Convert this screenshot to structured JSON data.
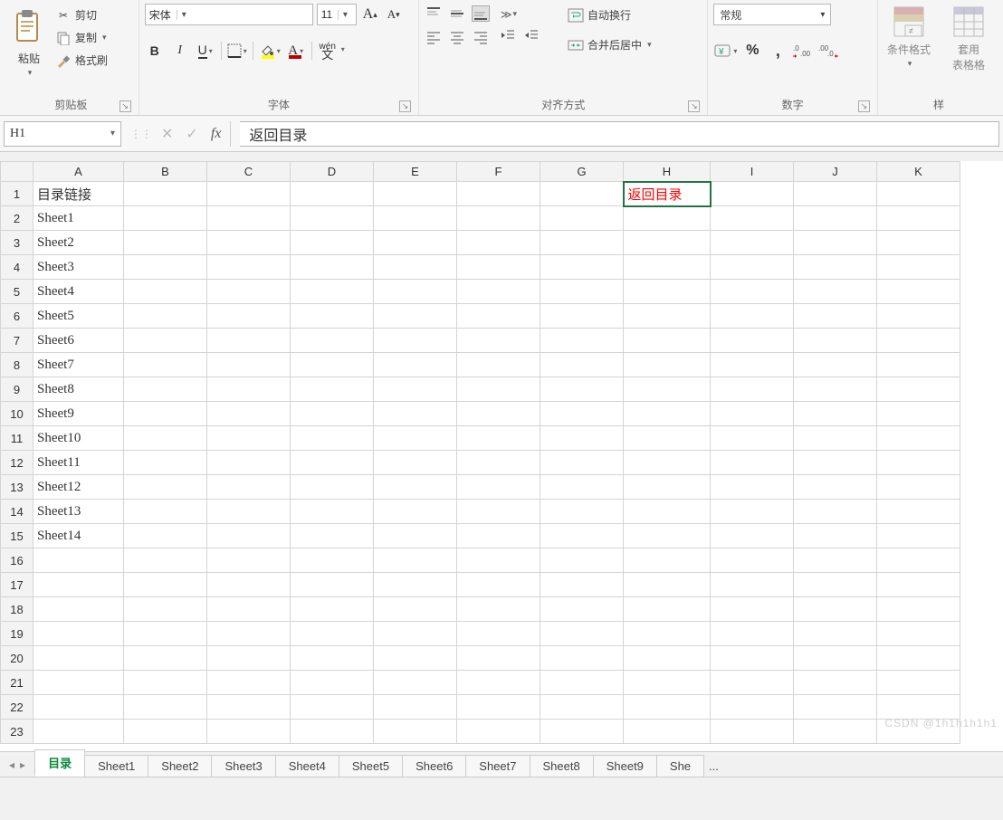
{
  "ribbon": {
    "clipboard": {
      "paste_label": "粘贴",
      "cut_label": "剪切",
      "copy_label": "复制",
      "painter_label": "格式刷",
      "group_label": "剪贴板"
    },
    "font": {
      "font_name": "宋体",
      "font_size": "11",
      "bold": "B",
      "italic": "I",
      "underline": "U",
      "pinyin": "wén",
      "group_label": "字体"
    },
    "align": {
      "wrap_label": "自动换行",
      "merge_label": "合并后居中",
      "group_label": "对齐方式"
    },
    "number": {
      "format_selected": "常规",
      "percent": "%",
      "comma": ",",
      "inc_dec_label": "",
      "group_label": "数字"
    },
    "styles": {
      "cond_fmt_label": "条件格式",
      "table_fmt_label": "套用\n表格格",
      "truncated_label": "样"
    }
  },
  "formula_bar": {
    "name_box": "H1",
    "fx": "fx",
    "value": "返回目录"
  },
  "grid": {
    "columns": [
      "A",
      "B",
      "C",
      "D",
      "E",
      "F",
      "G",
      "H",
      "I",
      "J",
      "K"
    ],
    "row_count": 23,
    "cells": {
      "A1": "目录链接",
      "H1": "返回目录",
      "A2": "Sheet1",
      "A3": "Sheet2",
      "A4": "Sheet3",
      "A5": "Sheet4",
      "A6": "Sheet5",
      "A7": "Sheet6",
      "A8": "Sheet7",
      "A9": "Sheet8",
      "A10": "Sheet9",
      "A11": "Sheet10",
      "A12": "Sheet11",
      "A13": "Sheet12",
      "A14": "Sheet13",
      "A15": "Sheet14"
    },
    "active_cell": "H1"
  },
  "tabs": {
    "items": [
      "目录",
      "Sheet1",
      "Sheet2",
      "Sheet3",
      "Sheet4",
      "Sheet5",
      "Sheet6",
      "Sheet7",
      "Sheet8",
      "Sheet9",
      "She"
    ],
    "active_index": 0,
    "more": "..."
  },
  "statusbar": {
    "watermark": "CSDN @1h1h1h1h1"
  }
}
